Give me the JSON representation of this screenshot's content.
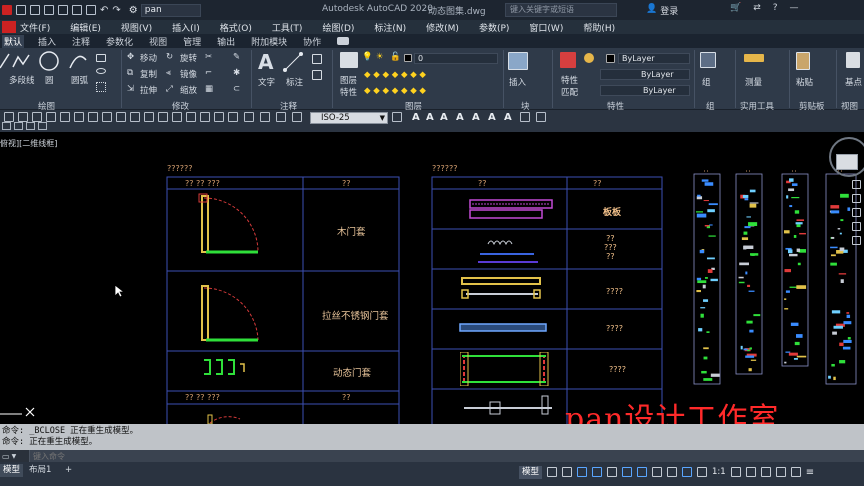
{
  "titlebar": {
    "workspace": "pan",
    "app_title": "Autodesk AutoCAD 2020",
    "filename": "动态图集.dwg",
    "search_placeholder": "键入关键字或短语",
    "login": "登录"
  },
  "menus": [
    "文件(F)",
    "编辑(E)",
    "视图(V)",
    "插入(I)",
    "格式(O)",
    "工具(T)",
    "绘图(D)",
    "标注(N)",
    "修改(M)",
    "参数(P)",
    "窗口(W)",
    "帮助(H)"
  ],
  "tabs": [
    "默认",
    "插入",
    "注释",
    "参数化",
    "视图",
    "管理",
    "输出",
    "附加模块",
    "协作"
  ],
  "active_tab": "默认",
  "ribbon": {
    "draw": {
      "polyline": "多段线",
      "circle": "圆",
      "arc": "圆弧",
      "panel": "绘图"
    },
    "modify": {
      "move": "移动",
      "rotate": "旋转",
      "copy": "复制",
      "mirror": "镜像",
      "stretch": "拉伸",
      "scale": "缩放",
      "panel": "修改"
    },
    "annotation": {
      "text": "文字",
      "dimension": "标注",
      "panel": "注释"
    },
    "layers": {
      "layer_props": "图层",
      "layer_props2": "特性",
      "current_layer": "0",
      "panel": "图层"
    },
    "block": {
      "insert": "插入",
      "panel": "块"
    },
    "properties": {
      "match_top": "特性",
      "match_bottom": "匹配",
      "color": "ByLayer",
      "linetype": "ByLayer",
      "lineweight": "ByLayer",
      "panel": "特性"
    },
    "groups": {
      "group": "组",
      "panel": "组"
    },
    "utilities": {
      "measure": "测量",
      "panel": "实用工具"
    },
    "clipboard": {
      "paste": "粘贴",
      "panel": "剪贴板"
    },
    "view": {
      "base": "基点",
      "panel": "视图"
    }
  },
  "toolbar2": {
    "dimstyle": "ISO-25"
  },
  "drawing": {
    "viewport_label": "俯视][二维线框]",
    "left_table": {
      "title": "??????",
      "header_left": "?? ?? ???",
      "header_right": "??",
      "rows": [
        "木门套",
        "拉丝不锈钢门套",
        "动态门套"
      ],
      "row4_left": "?? ?? ???",
      "row4_right": "??"
    },
    "right_table": {
      "title": "??????",
      "header_left": "??",
      "header_right": "??",
      "rows": [
        "板板",
        "??\n???\n??",
        "????",
        "????",
        "????"
      ]
    },
    "sheets_labels": [
      "??",
      "??",
      "??",
      "??",
      "??"
    ],
    "watermark": "pan设计工作室"
  },
  "command": {
    "history": [
      "命令: _BCLOSE 正在重生成模型。",
      "命令: 正在重生成模型。"
    ],
    "placeholder": "键入命令"
  },
  "statusbar": {
    "layout_tabs": [
      "模型",
      "布局1"
    ],
    "add_tab": "+",
    "model_button": "模型",
    "scale": "1:1"
  }
}
